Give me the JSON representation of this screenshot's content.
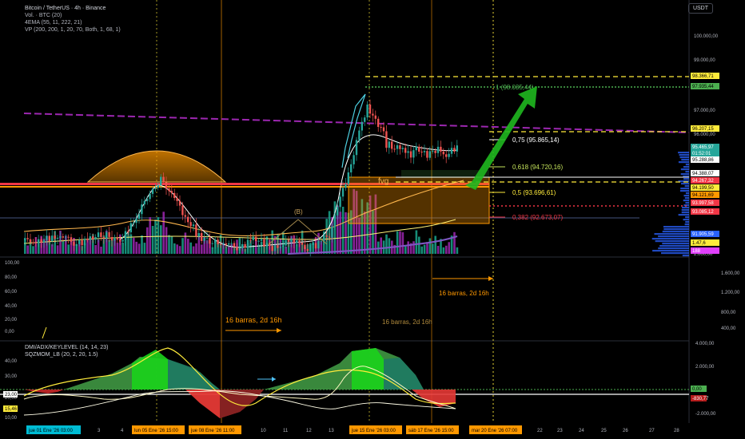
{
  "header": {
    "symbol_line": "Bitcoin / TetherUS · 4h · Binance",
    "vol_line": "Vol. · BTC (20)",
    "ema_line": "4EMA (55, 11, 222, 21)",
    "vp_line": "VP (200, 200, 1, 20, 70, Both, 1, 68, 1)",
    "currency_button": "USDT"
  },
  "oscillator": {
    "title_line": "DMI/ADX/KEYLEVEL (14, 14, 23)",
    "sqz_line": "SQZMOM_LB (20, 2, 20, 1.5)"
  },
  "colors": {
    "background": "#000000",
    "candle_up": "#26a69a",
    "candle_down": "#ef5350",
    "volume_purple": "#9c27b0",
    "fib_yellow": "#ffeb3b",
    "fib_red": "#f23645",
    "fib_green": "#c5e45b",
    "purple_dashed": "#9c27b0",
    "orange": "#ff9800",
    "arrow_green": "#1fb81f"
  },
  "price_axis": {
    "labels": [
      "100.000,00",
      "99.000,00",
      "97.000,00",
      "96.000,00",
      "95.288,86",
      "2.000,00"
    ],
    "tags": [
      {
        "text": "98.366,71",
        "bg": "#ffeb3b",
        "fg": "#000000"
      },
      {
        "text": "97.935,44",
        "bg": "#4caf50",
        "fg": "#000000"
      },
      {
        "text": "96.207,15",
        "bg": "#ffeb3b",
        "fg": "#000000"
      },
      {
        "text": "95.465,97",
        "bg": "#26a69a",
        "fg": "#ffffff"
      },
      {
        "text": "01:52:01",
        "bg": "#26a69a",
        "fg": "#ffffff"
      },
      {
        "text": "95.288,86",
        "bg": "#ffffff",
        "fg": "#000000"
      },
      {
        "text": "94.388,07",
        "bg": "#ffffff",
        "fg": "#000000"
      },
      {
        "text": "94.267,32",
        "bg": "#f23645",
        "fg": "#ffffff"
      },
      {
        "text": "94.199,50",
        "bg": "#ffeb3b",
        "fg": "#000000"
      },
      {
        "text": "94.121,69",
        "bg": "#ff9800",
        "fg": "#000000"
      },
      {
        "text": "93.997,58",
        "bg": "#f23645",
        "fg": "#ffffff"
      },
      {
        "text": "93.085,12",
        "bg": "#f23645",
        "fg": "#ffffff"
      },
      {
        "text": "91.905,59",
        "bg": "#2962ff",
        "fg": "#ffffff"
      },
      {
        "text": "1.47,6",
        "bg": "#ffeb3b",
        "fg": "#000000"
      },
      {
        "text": "188",
        "bg": "#e040fb",
        "fg": "#ffffff"
      }
    ]
  },
  "fib_labels": [
    {
      "text": "1 (98.035,44)",
      "color": "#4caf50"
    },
    {
      "text": "0,75 (95.865,14)",
      "color": "#ffffff"
    },
    {
      "text": "0,618 (94.720,16)",
      "color": "#c5e45b"
    },
    {
      "text": "0,5 (93.696,61)",
      "color": "#ffeb3b"
    },
    {
      "text": "0,382 (92.673,07)",
      "color": "#f23645"
    }
  ],
  "annotations": {
    "fvg": "fvg",
    "wave_b": "(B)",
    "bars_orange": "16 barras, 2d 16h",
    "bars_mid": "16 barras, 2d 16h",
    "bars_right": "16 barras, 2d 16h"
  },
  "rsi_axis": {
    "left_labels": [
      "100,00",
      "80,00",
      "60,00",
      "40,00",
      "20,00",
      "0,00"
    ],
    "right_labels": [
      "1.600,00",
      "1.200,00",
      "800,00",
      "400,00"
    ]
  },
  "osc_axis": {
    "left_labels": [
      "40,00",
      "30,00",
      "23,00",
      "20,00",
      "15,46",
      "10,00"
    ],
    "right_labels": [
      "4.000,00",
      "2.000,00",
      "0,00",
      "-2.000,00"
    ],
    "tags": [
      {
        "text": "0,00",
        "bg": "#4caf50",
        "fg": "#000000"
      },
      {
        "text": "-830,77",
        "bg": "#b71c1c",
        "fg": "#ffffff"
      },
      {
        "text": "23,00",
        "bg": "#ffffff",
        "fg": "#000000"
      },
      {
        "text": "15,46",
        "bg": "#ffeb3b",
        "fg": "#000000"
      }
    ]
  },
  "time_axis": {
    "ticks": [
      {
        "text": "jue 01 Ene '26   03:00",
        "highlight": "#00bcd4"
      },
      {
        "text": "3",
        "highlight": ""
      },
      {
        "text": "4",
        "highlight": ""
      },
      {
        "text": "lun 05 Ene '26   15:00",
        "highlight": "#ff9800"
      },
      {
        "text": "jue 08 Ene '26   11:00",
        "highlight": "#ff9800"
      },
      {
        "text": "10",
        "highlight": ""
      },
      {
        "text": "11",
        "highlight": ""
      },
      {
        "text": "12",
        "highlight": ""
      },
      {
        "text": "13",
        "highlight": ""
      },
      {
        "text": "jue 15 Ene '26   03:00",
        "highlight": "#ff9800"
      },
      {
        "text": "sáb 17 Ene '26   15:00",
        "highlight": "#ff9800"
      },
      {
        "text": "mar 20 Ene '26   07:00",
        "highlight": "#ff9800"
      },
      {
        "text": "22",
        "highlight": ""
      },
      {
        "text": "23",
        "highlight": ""
      },
      {
        "text": "24",
        "highlight": ""
      },
      {
        "text": "25",
        "highlight": ""
      },
      {
        "text": "26",
        "highlight": ""
      },
      {
        "text": "27",
        "highlight": ""
      },
      {
        "text": "28",
        "highlight": ""
      }
    ]
  }
}
